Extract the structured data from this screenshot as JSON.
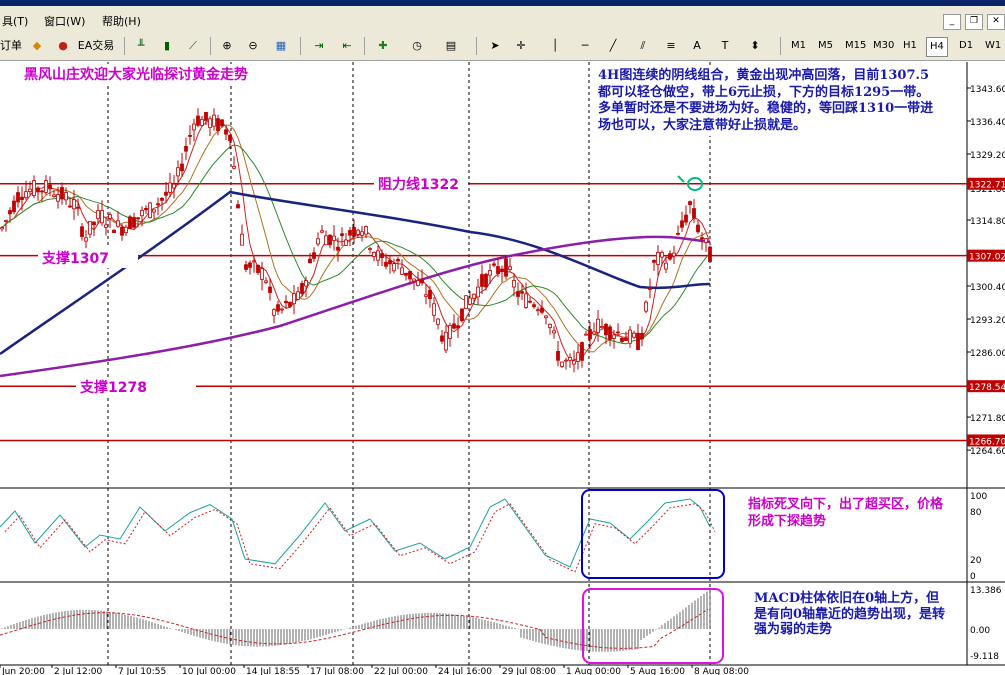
{
  "menu": {
    "items": [
      "具(T)",
      "窗口(W)",
      "帮助(H)"
    ]
  },
  "toolbar": {
    "new_order": "订单",
    "ea_trade": "EA交易",
    "periods": [
      "M1",
      "M5",
      "M15",
      "M30",
      "H1",
      "H4",
      "D1",
      "W1"
    ],
    "active_period": "H4"
  },
  "colors": {
    "resistance": "#c00000",
    "support": "#c00000",
    "ma_purple": "#8b1fa8",
    "ma_navy": "#1a237e",
    "annotation": "#cc00cc",
    "note_text": "#1a1aaa"
  },
  "annotations": {
    "header": "黑风山庄欢迎大家光临探讨黄金走势",
    "main_note": "4H图连续的阴线组合，黄金出现冲高回落，目前1307.5都可以轻仓做空，带上6元止损，下方的目标1295一带。多单暂时还是不要进场为好。稳健的，等回踩1310一带进场也可以，大家注意带好止损就是。",
    "resistance": "阻力线1322",
    "support1": "支撑1307",
    "support2": "支撑1278",
    "stoch_note": "指标死叉向下，出了超买区，价格形成下探趋势",
    "macd_note": "MACD柱体依旧在0轴上方，但是有向0轴靠近的趋势出现，是转强为弱的走势"
  },
  "price_axis": {
    "ticks": [
      "1343.60",
      "1336.40",
      "1329.20",
      "1321.80",
      "1314.80",
      "1307.60",
      "1300.40",
      "1293.20",
      "1286.00",
      "1278.80",
      "1271.80",
      "1264.60"
    ],
    "hline_labels": [
      "1322.71",
      "1307.02",
      "1278.54",
      "1266.70"
    ]
  },
  "stoch_axis": {
    "ticks": [
      "100",
      "80",
      "20",
      "0"
    ]
  },
  "macd_axis": {
    "ticks": [
      "13.386",
      "0.00",
      "-9.118"
    ]
  },
  "time_axis": {
    "labels": [
      "Jun 20:00",
      "2 Jul 12:00",
      "7 Jul 10:55",
      "10 Jul 00:00",
      "14 Jul 18:55",
      "17 Jul 08:00",
      "22 Jul 00:00",
      "24 Jul 16:00",
      "29 Jul 08:00",
      "1 Aug 00:00",
      "5 Aug 16:00",
      "8 Aug 08:00"
    ]
  }
}
